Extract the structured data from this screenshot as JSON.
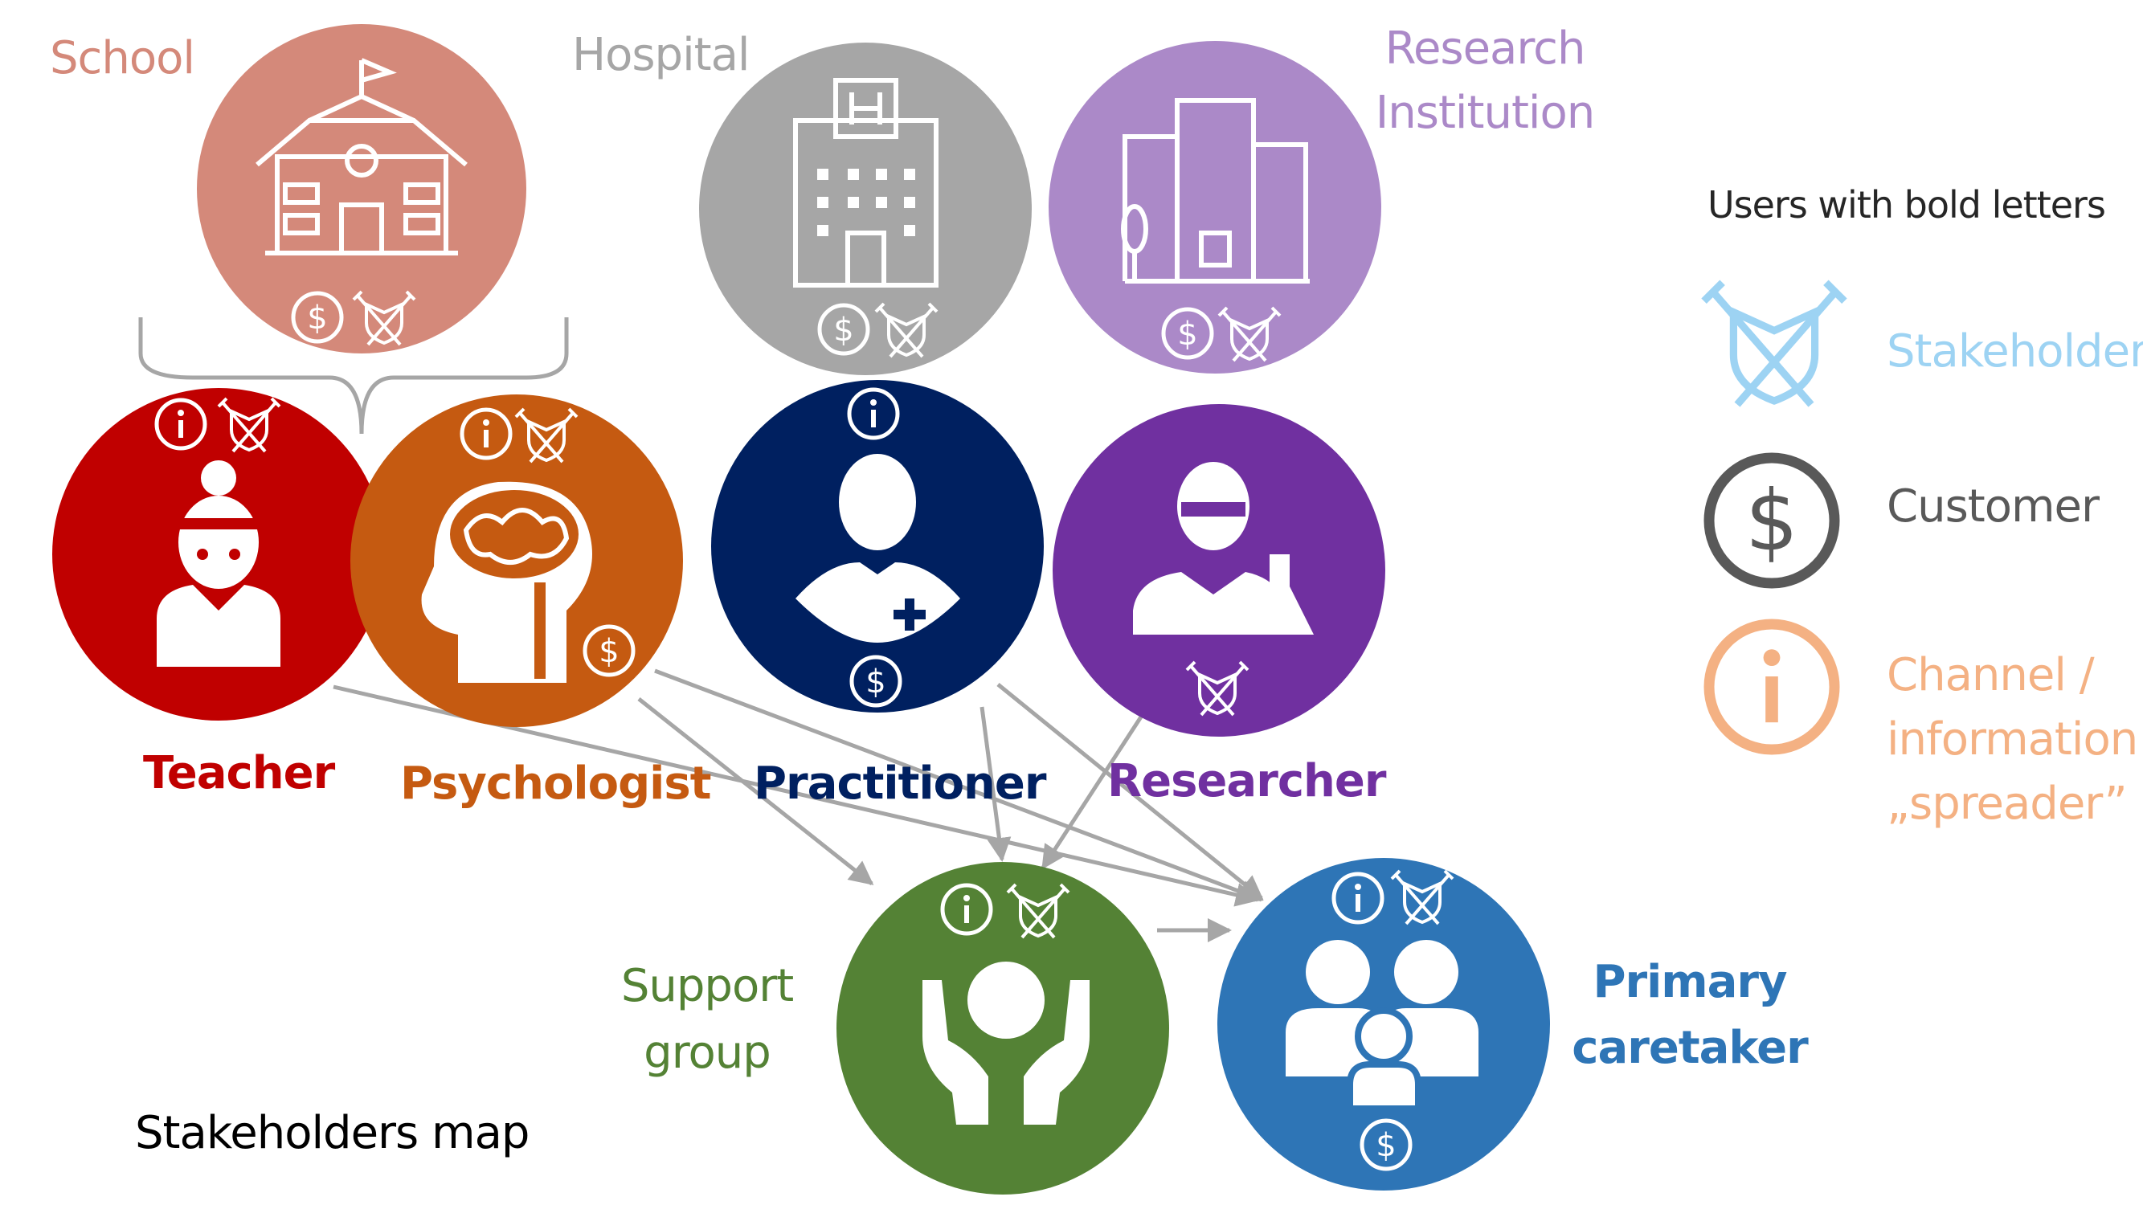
{
  "title": "Stakeholders map",
  "organizations": [
    {
      "id": "school",
      "label": "School",
      "color": "#d4897a"
    },
    {
      "id": "hospital",
      "label": "Hospital",
      "color": "#a6a6a6"
    },
    {
      "id": "research_institution",
      "label": "Research Institution",
      "line1": "Research",
      "line2": "Institution",
      "color": "#ab89c8"
    }
  ],
  "users": [
    {
      "id": "teacher",
      "label": "Teacher",
      "color": "#c00000"
    },
    {
      "id": "psychologist",
      "label": "Psychologist",
      "color": "#c55a11"
    },
    {
      "id": "practitioner",
      "label": "Practitioner",
      "color": "#002060"
    },
    {
      "id": "researcher",
      "label": "Researcher",
      "color": "#7030a0"
    },
    {
      "id": "support_group",
      "label": "Support group",
      "line1": "Support",
      "line2": "group",
      "color": "#548235"
    },
    {
      "id": "primary_caretaker",
      "label": "Primary caretaker",
      "line1": "Primary",
      "line2": "caretaker",
      "color": "#2e75b6"
    }
  ],
  "legend": {
    "heading": "Users with bold letters",
    "items": [
      {
        "icon": "shield-swords-icon",
        "label": "Stakeholder",
        "color": "#9dd3f3"
      },
      {
        "icon": "dollar-icon",
        "label": "Customer",
        "color": "#595959"
      },
      {
        "icon": "info-icon",
        "label": "Channel / information „spreader”",
        "line1": "Channel /",
        "line2": "information",
        "line3": "„spreader”",
        "color": "#f4b183"
      }
    ]
  },
  "colors": {
    "arrow": "#a6a6a6",
    "brace": "#a6a6a6",
    "title": "#000000",
    "legend_heading": "#262626"
  }
}
